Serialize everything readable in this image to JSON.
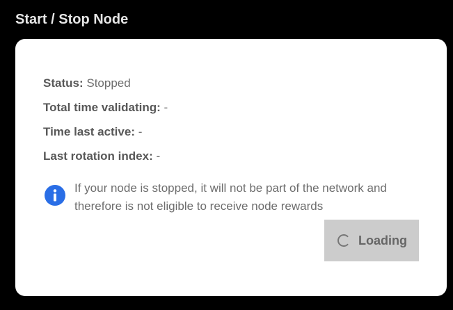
{
  "header": {
    "title": "Start / Stop Node"
  },
  "status_panel": {
    "rows": [
      {
        "label": "Status:",
        "value": "Stopped"
      },
      {
        "label": "Total time validating:",
        "value": "-"
      },
      {
        "label": "Time last active:",
        "value": "-"
      },
      {
        "label": "Last rotation index:",
        "value": "-"
      }
    ]
  },
  "notice": {
    "icon": "info-icon",
    "text": "If your node is stopped, it will not be part of the network and therefore is not eligible to receive node rewards"
  },
  "action_button": {
    "label": "Loading",
    "icon": "spinner-icon"
  },
  "colors": {
    "background": "#000000",
    "card": "#ffffff",
    "info_icon": "#2a6ee6",
    "button_disabled": "#cccccc"
  }
}
